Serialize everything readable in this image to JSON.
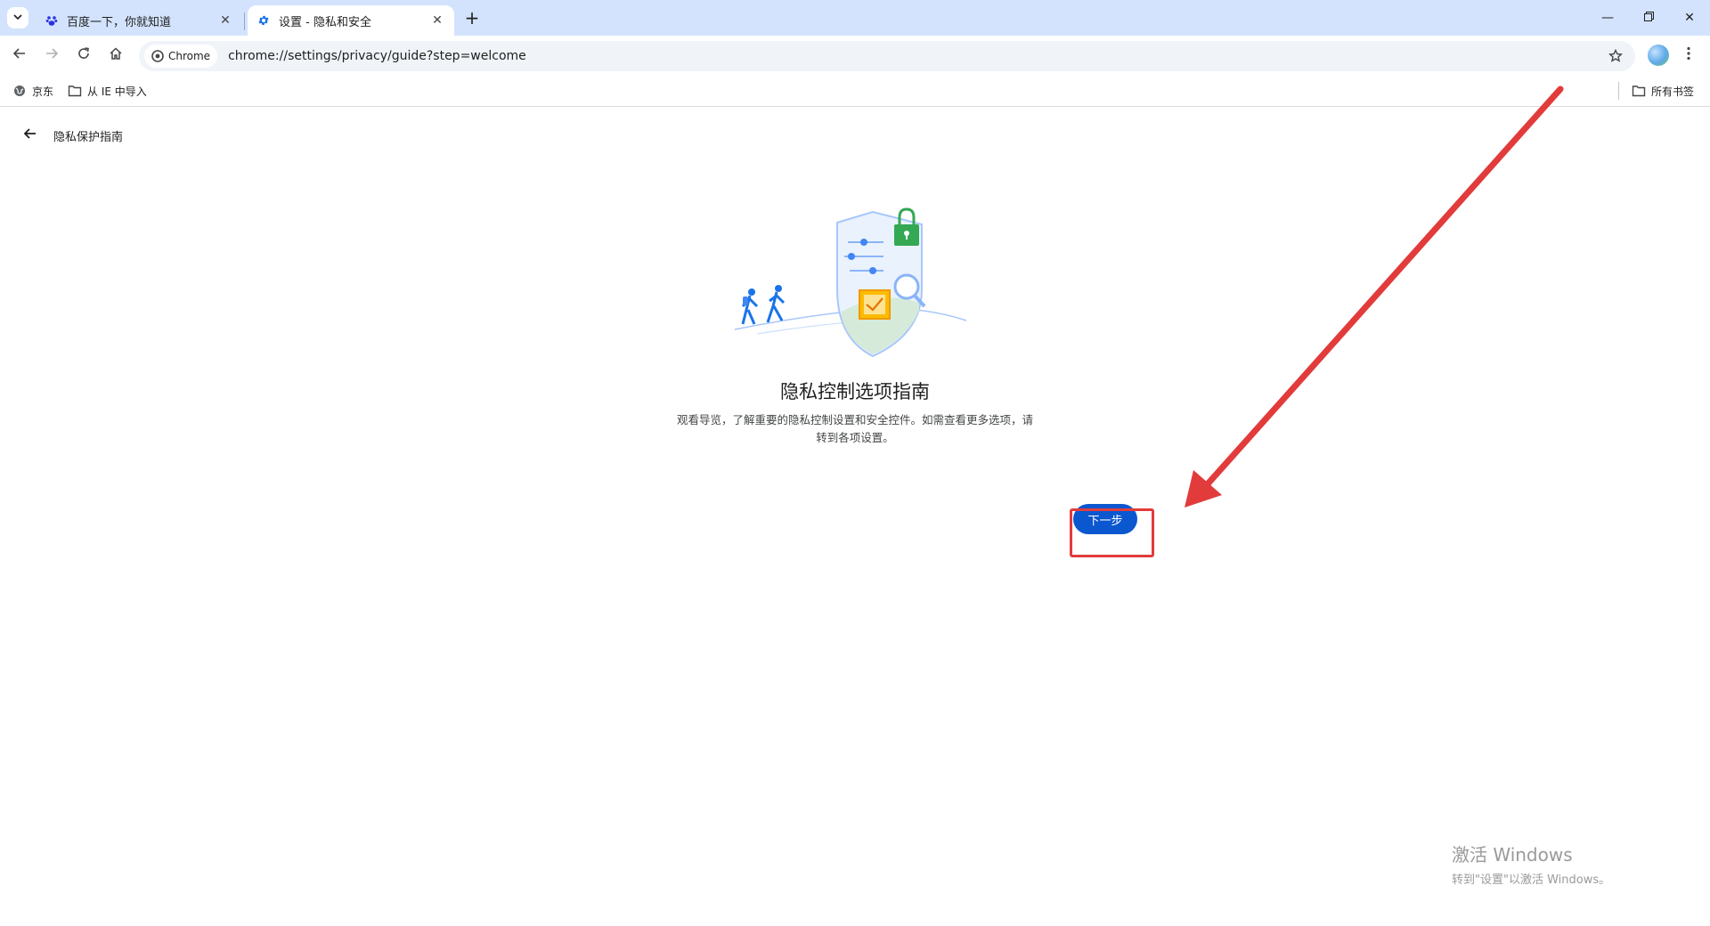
{
  "tabs": [
    {
      "title": "百度一下，你就知道",
      "icon": "baidu-paw-icon",
      "active": false
    },
    {
      "title": "设置 - 隐私和安全",
      "icon": "gear-icon",
      "active": true
    }
  ],
  "toolbar": {
    "chip_label": "Chrome",
    "url": "chrome://settings/privacy/guide?step=welcome"
  },
  "bookmarks": {
    "items": [
      {
        "label": "京东",
        "icon": "globe-icon"
      },
      {
        "label": "从 IE 中导入",
        "icon": "folder-icon"
      }
    ],
    "all_label": "所有书签"
  },
  "page": {
    "back_title": "隐私保护指南",
    "heading": "隐私控制选项指南",
    "description": "观看导览，了解重要的隐私控制设置和安全控件。如需查看更多选项，请转到各项设置。",
    "next_label": "下一步"
  },
  "colors": {
    "tabstrip": "#d3e3fd",
    "primary_button": "#0b57d0",
    "annotation": "#e23b3b"
  },
  "watermark": {
    "title": "激活 Windows",
    "subtitle": "转到\"设置\"以激活 Windows。"
  }
}
